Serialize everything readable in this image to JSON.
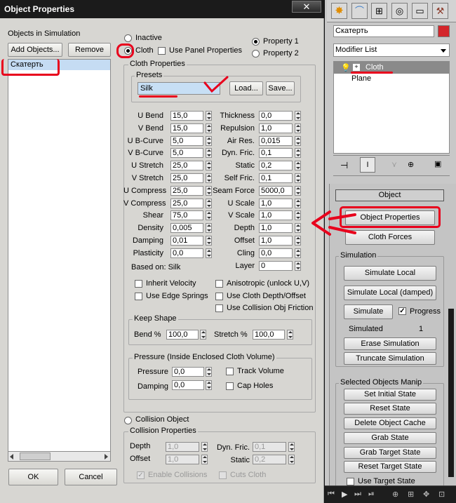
{
  "dialog": {
    "title": "Object Properties",
    "close_glyph": "✕",
    "objects_label": "Objects in Simulation",
    "add_objects": "Add Objects...",
    "remove": "Remove",
    "list_items": [
      "Скатерть"
    ],
    "ok": "OK",
    "cancel": "Cancel"
  },
  "mode": {
    "inactive": "Inactive",
    "cloth": "Cloth",
    "use_panel": "Use Panel Properties",
    "property1": "Property 1",
    "property2": "Property 2",
    "collision_object": "Collision Object"
  },
  "cloth_properties": {
    "title": "Cloth Properties",
    "presets_title": "Presets",
    "preset_value": "Silk",
    "load": "Load...",
    "save": "Save...",
    "left_params": [
      {
        "label": "U Bend",
        "value": "15,0"
      },
      {
        "label": "V Bend",
        "value": "15,0"
      },
      {
        "label": "U B-Curve",
        "value": "5,0"
      },
      {
        "label": "V B-Curve",
        "value": "5,0"
      },
      {
        "label": "U Stretch",
        "value": "25,0"
      },
      {
        "label": "V Stretch",
        "value": "25,0"
      },
      {
        "label": "U Compress",
        "value": "25,0"
      },
      {
        "label": "V Compress",
        "value": "25,0"
      },
      {
        "label": "Shear",
        "value": "75,0"
      },
      {
        "label": "Density",
        "value": "0,005"
      },
      {
        "label": "Damping",
        "value": "0,01"
      },
      {
        "label": "Plasticity",
        "value": "0,0"
      }
    ],
    "right_params": [
      {
        "label": "Thickness",
        "value": "0,0"
      },
      {
        "label": "Repulsion",
        "value": "1,0"
      },
      {
        "label": "Air Res.",
        "value": "0,015"
      },
      {
        "label": "Dyn. Fric.",
        "value": "0,1"
      },
      {
        "label": "Static",
        "value": "0,2"
      },
      {
        "label": "Self Fric.",
        "value": "0,1"
      },
      {
        "label": "Seam Force",
        "value": "5000,0"
      },
      {
        "label": "U Scale",
        "value": "1,0"
      },
      {
        "label": "V Scale",
        "value": "1,0"
      },
      {
        "label": "Depth",
        "value": "1,0"
      },
      {
        "label": "Offset",
        "value": "1,0"
      },
      {
        "label": "Cling",
        "value": "0,0"
      },
      {
        "label": "Layer",
        "value": "0"
      }
    ],
    "based_on": "Based on: Silk",
    "checks": {
      "inherit_velocity": "Inherit Velocity",
      "anisotropic": "Anisotropic (unlock U,V)",
      "use_edge_springs": "Use Edge Springs",
      "use_cloth_depth": "Use Cloth Depth/Offset",
      "use_collision_friction": "Use Collision Obj Friction"
    }
  },
  "keep_shape": {
    "title": "Keep Shape",
    "bend_label": "Bend %",
    "bend_value": "100,0",
    "stretch_label": "Stretch %",
    "stretch_value": "100,0"
  },
  "pressure": {
    "title": "Pressure (Inside Enclosed Cloth Volume)",
    "pressure_label": "Pressure",
    "pressure_value": "0,0",
    "damping_label": "Damping",
    "damping_value": "0,0",
    "track_volume": "Track Volume",
    "cap_holes": "Cap Holes"
  },
  "collision": {
    "title": "Collision Properties",
    "depth_label": "Depth",
    "depth_value": "1,0",
    "offset_label": "Offset",
    "offset_value": "1,0",
    "dyn_fric_label": "Dyn. Fric.",
    "dyn_fric_value": "0,1",
    "static_label": "Static",
    "static_value": "0,2",
    "enable_collisions": "Enable Collisions",
    "cuts_cloth": "Cuts Cloth"
  },
  "panel": {
    "object_name": "Скатерть",
    "object_color": "#d3262b",
    "modifier_list": "Modifier List",
    "stack_cloth": "Cloth",
    "stack_plane": "Plane",
    "object_section": "Object",
    "object_properties": "Object Properties",
    "cloth_forces": "Cloth Forces",
    "simulation_title": "Simulation",
    "simulate_local": "Simulate Local",
    "simulate_local_damped": "Simulate Local (damped)",
    "simulate": "Simulate",
    "progress": "Progress",
    "simulated_label": "Simulated",
    "simulated_value": "1",
    "erase_simulation": "Erase Simulation",
    "truncate_simulation": "Truncate Simulation",
    "selected_title": "Selected Objects Manip",
    "set_initial_state": "Set Initial State",
    "reset_state": "Reset State",
    "delete_object_cache": "Delete Object Cache",
    "grab_state": "Grab State",
    "grab_target_state": "Grab Target State",
    "reset_target_state": "Reset Target State",
    "use_target_state": "Use Target State"
  },
  "colors": {
    "annotation_red": "#e8001c",
    "title_bar": "#1b1b1b",
    "dialog_bg": "#d7d6d2",
    "selection_blue": "#c5dcf3"
  }
}
